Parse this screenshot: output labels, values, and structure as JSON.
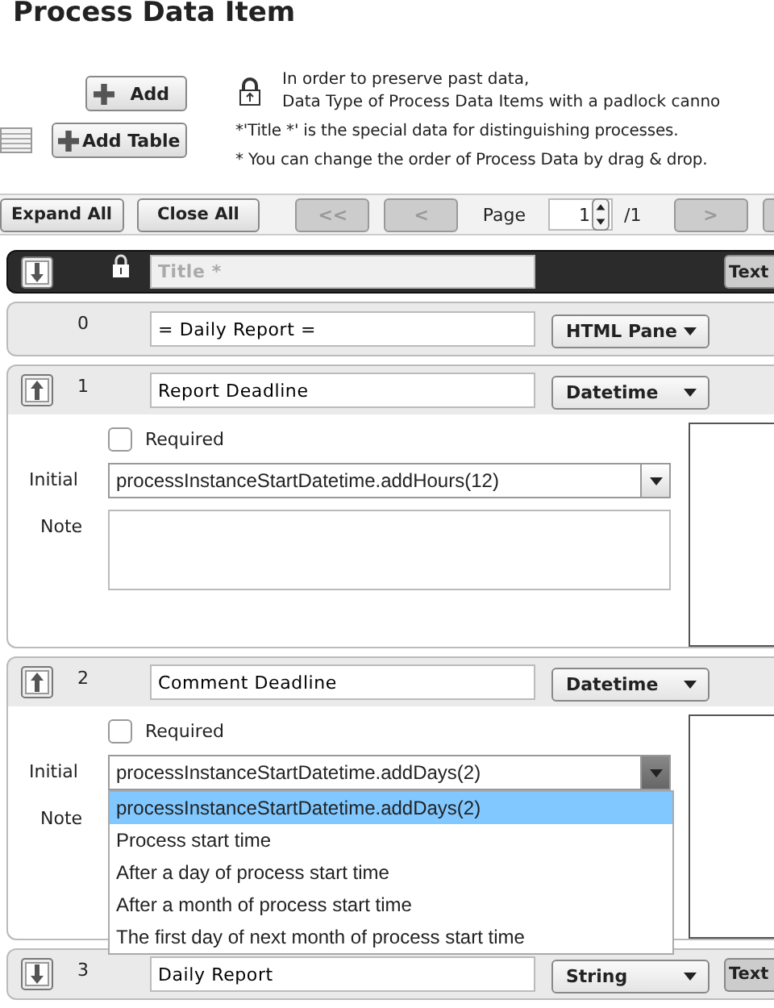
{
  "title": "Process Data Item",
  "add_button": "Add",
  "add_table_button": "Add Table",
  "lock_notes": [
    "In order to preserve past data,",
    "Data Type of Process Data Items with a padlock canno"
  ],
  "notes": [
    "*'Title *' is the special data for distinguishing processes.",
    "* You can change the order of Process Data by drag & drop."
  ],
  "toolbar": {
    "expand_all": "Expand All",
    "close_all": "Close All",
    "first": "<<",
    "prev": "<",
    "page_label": "Page",
    "page_value": "1",
    "page_total": "/1",
    "next": ">"
  },
  "items": [
    {
      "kind": "title",
      "locked": true,
      "collapsible": true,
      "expanded": false,
      "placeholder": "Title *",
      "text_button": "Text"
    },
    {
      "kind": "item",
      "number": "0",
      "name": "= Daily Report =",
      "type": "HTML Pane"
    },
    {
      "kind": "item",
      "number": "1",
      "collapsible": true,
      "name": "Report Deadline",
      "type": "Datetime",
      "expanded": true,
      "required_label": "Required",
      "required": false,
      "initial_label": "Initial",
      "initial": "processInstanceStartDatetime.addHours(12)",
      "note_label": "Note",
      "dropdown_open": false
    },
    {
      "kind": "item",
      "number": "2",
      "collapsible": true,
      "name": "Comment Deadline",
      "type": "Datetime",
      "expanded": true,
      "required_label": "Required",
      "required": false,
      "initial_label": "Initial",
      "initial": "processInstanceStartDatetime.addDays(2)",
      "note_label": "Note",
      "dropdown_open": true,
      "options": [
        {
          "label": "processInstanceStartDatetime.addDays(2)",
          "selected": true
        },
        {
          "label": "Process start time",
          "selected": false
        },
        {
          "label": "After a day of process start time",
          "selected": false
        },
        {
          "label": "After a month of process start time",
          "selected": false
        },
        {
          "label": "The first day of next month of process start time",
          "selected": false
        }
      ]
    },
    {
      "kind": "item",
      "number": "3",
      "collapsible": true,
      "expanded": false,
      "name": "Daily Report",
      "type": "String",
      "text_button": "Text"
    }
  ]
}
